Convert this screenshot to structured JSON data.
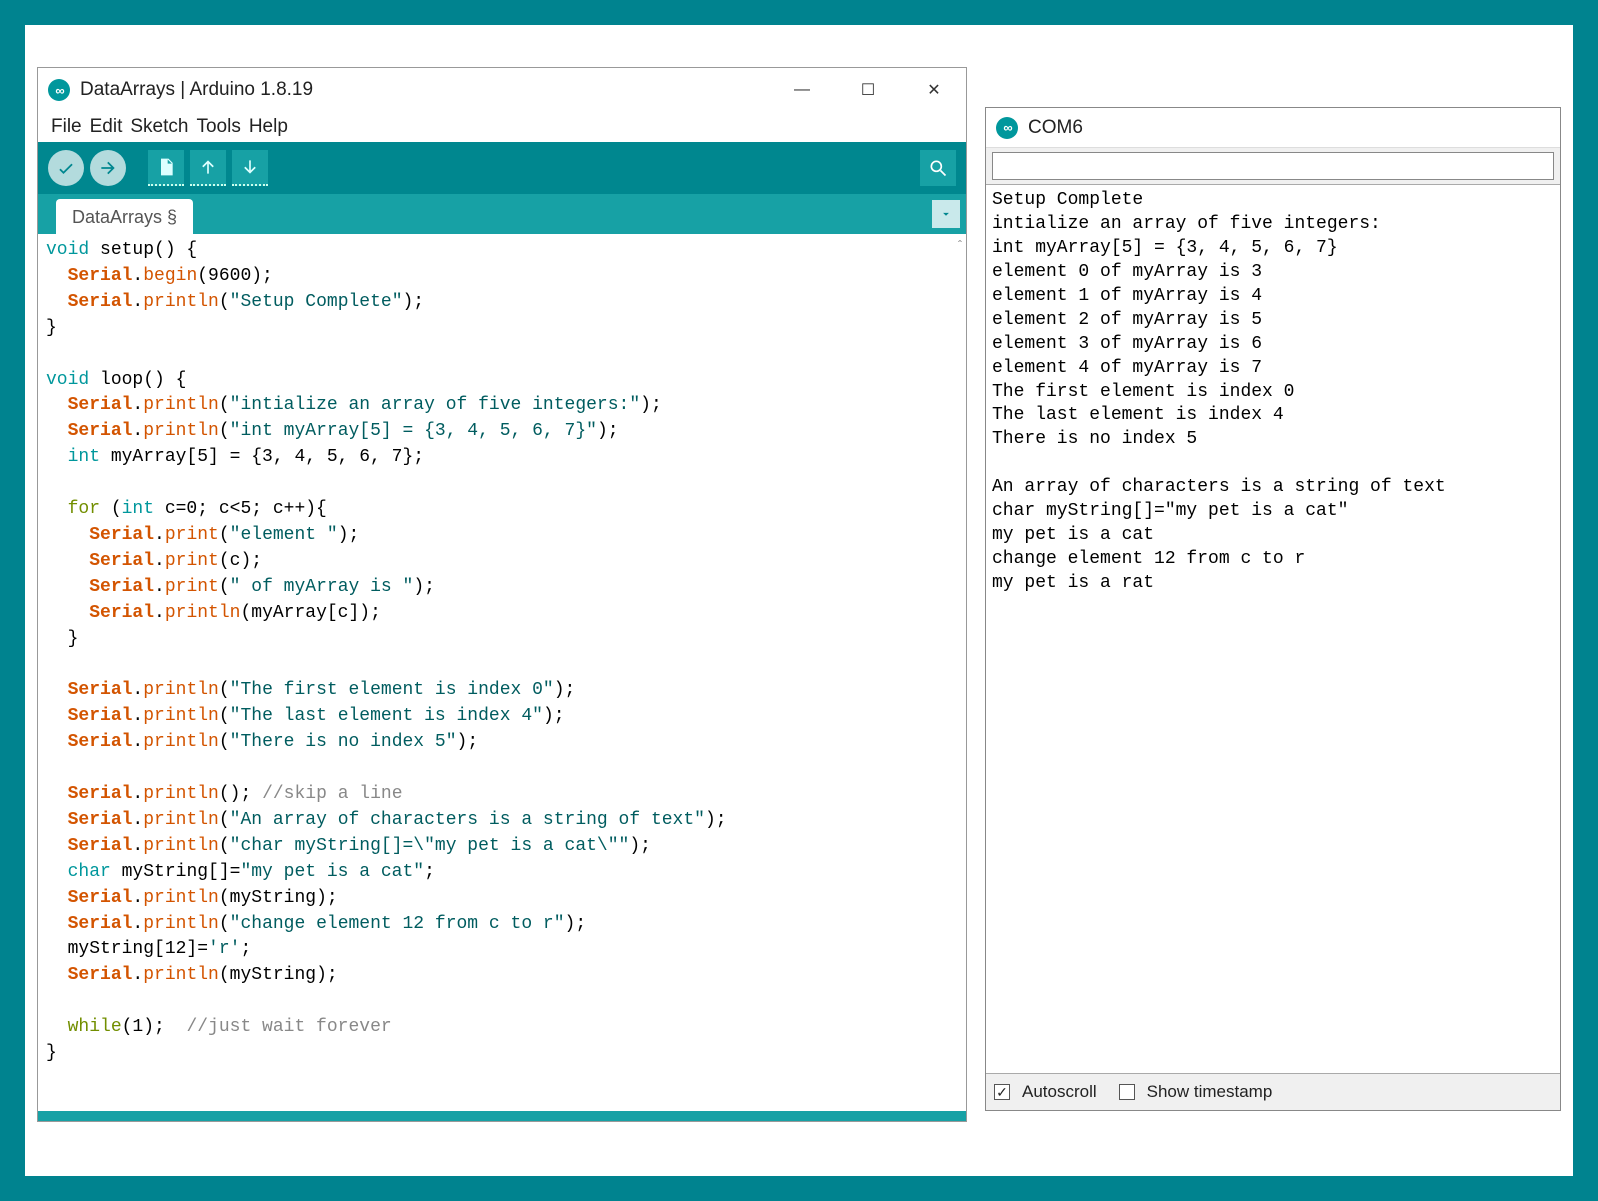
{
  "ide": {
    "title": "DataArrays | Arduino 1.8.19",
    "menubar": [
      "File",
      "Edit",
      "Sketch",
      "Tools",
      "Help"
    ],
    "tab": "DataArrays §",
    "code_tokens": [
      [
        [
          "kw-type",
          "void"
        ],
        [
          "",
          " setup() {"
        ]
      ],
      [
        [
          "",
          "  "
        ],
        [
          "kw-serial",
          "Serial"
        ],
        [
          "",
          "."
        ],
        [
          "kw-func",
          "begin"
        ],
        [
          "",
          "(9600);"
        ]
      ],
      [
        [
          "",
          "  "
        ],
        [
          "kw-serial",
          "Serial"
        ],
        [
          "",
          "."
        ],
        [
          "kw-func",
          "println"
        ],
        [
          "",
          "("
        ],
        [
          "str",
          "\"Setup Complete\""
        ],
        [
          "",
          ");"
        ]
      ],
      [
        [
          "",
          "}"
        ]
      ],
      [
        [
          "",
          ""
        ]
      ],
      [
        [
          "kw-type",
          "void"
        ],
        [
          "",
          " loop() {"
        ]
      ],
      [
        [
          "",
          "  "
        ],
        [
          "kw-serial",
          "Serial"
        ],
        [
          "",
          "."
        ],
        [
          "kw-func",
          "println"
        ],
        [
          "",
          "("
        ],
        [
          "str",
          "\"intialize an array of five integers:\""
        ],
        [
          "",
          ");"
        ]
      ],
      [
        [
          "",
          "  "
        ],
        [
          "kw-serial",
          "Serial"
        ],
        [
          "",
          "."
        ],
        [
          "kw-func",
          "println"
        ],
        [
          "",
          "("
        ],
        [
          "str",
          "\"int myArray[5] = {3, 4, 5, 6, 7}\""
        ],
        [
          "",
          ");"
        ]
      ],
      [
        [
          "",
          "  "
        ],
        [
          "kw-type",
          "int"
        ],
        [
          "",
          " myArray[5] = {3, 4, 5, 6, 7};"
        ]
      ],
      [
        [
          "",
          ""
        ]
      ],
      [
        [
          "",
          "  "
        ],
        [
          "kw-ctrl",
          "for"
        ],
        [
          "",
          " ("
        ],
        [
          "kw-type",
          "int"
        ],
        [
          "",
          " c=0; c<5; c++){"
        ]
      ],
      [
        [
          "",
          "    "
        ],
        [
          "kw-serial",
          "Serial"
        ],
        [
          "",
          "."
        ],
        [
          "kw-func",
          "print"
        ],
        [
          "",
          "("
        ],
        [
          "str",
          "\"element \""
        ],
        [
          "",
          ");"
        ]
      ],
      [
        [
          "",
          "    "
        ],
        [
          "kw-serial",
          "Serial"
        ],
        [
          "",
          "."
        ],
        [
          "kw-func",
          "print"
        ],
        [
          "",
          "(c);"
        ]
      ],
      [
        [
          "",
          "    "
        ],
        [
          "kw-serial",
          "Serial"
        ],
        [
          "",
          "."
        ],
        [
          "kw-func",
          "print"
        ],
        [
          "",
          "("
        ],
        [
          "str",
          "\" of myArray is \""
        ],
        [
          "",
          ");"
        ]
      ],
      [
        [
          "",
          "    "
        ],
        [
          "kw-serial",
          "Serial"
        ],
        [
          "",
          "."
        ],
        [
          "kw-func",
          "println"
        ],
        [
          "",
          "(myArray[c]);"
        ]
      ],
      [
        [
          "",
          "  }"
        ]
      ],
      [
        [
          "",
          ""
        ]
      ],
      [
        [
          "",
          "  "
        ],
        [
          "kw-serial",
          "Serial"
        ],
        [
          "",
          "."
        ],
        [
          "kw-func",
          "println"
        ],
        [
          "",
          "("
        ],
        [
          "str",
          "\"The first element is index 0\""
        ],
        [
          "",
          ");"
        ]
      ],
      [
        [
          "",
          "  "
        ],
        [
          "kw-serial",
          "Serial"
        ],
        [
          "",
          "."
        ],
        [
          "kw-func",
          "println"
        ],
        [
          "",
          "("
        ],
        [
          "str",
          "\"The last element is index 4\""
        ],
        [
          "",
          ");"
        ]
      ],
      [
        [
          "",
          "  "
        ],
        [
          "kw-serial",
          "Serial"
        ],
        [
          "",
          "."
        ],
        [
          "kw-func",
          "println"
        ],
        [
          "",
          "("
        ],
        [
          "str",
          "\"There is no index 5\""
        ],
        [
          "",
          ");"
        ]
      ],
      [
        [
          "",
          ""
        ]
      ],
      [
        [
          "",
          "  "
        ],
        [
          "kw-serial",
          "Serial"
        ],
        [
          "",
          "."
        ],
        [
          "kw-func",
          "println"
        ],
        [
          "",
          "(); "
        ],
        [
          "cmt",
          "//skip a line"
        ]
      ],
      [
        [
          "",
          "  "
        ],
        [
          "kw-serial",
          "Serial"
        ],
        [
          "",
          "."
        ],
        [
          "kw-func",
          "println"
        ],
        [
          "",
          "("
        ],
        [
          "str",
          "\"An array of characters is a string of text\""
        ],
        [
          "",
          ");"
        ]
      ],
      [
        [
          "",
          "  "
        ],
        [
          "kw-serial",
          "Serial"
        ],
        [
          "",
          "."
        ],
        [
          "kw-func",
          "println"
        ],
        [
          "",
          "("
        ],
        [
          "str",
          "\"char myString[]=\\\"my pet is a cat\\\"\""
        ],
        [
          "",
          ");"
        ]
      ],
      [
        [
          "",
          "  "
        ],
        [
          "kw-type",
          "char"
        ],
        [
          "",
          " myString[]="
        ],
        [
          "str",
          "\"my pet is a cat\""
        ],
        [
          "",
          ";"
        ]
      ],
      [
        [
          "",
          "  "
        ],
        [
          "kw-serial",
          "Serial"
        ],
        [
          "",
          "."
        ],
        [
          "kw-func",
          "println"
        ],
        [
          "",
          "(myString);"
        ]
      ],
      [
        [
          "",
          "  "
        ],
        [
          "kw-serial",
          "Serial"
        ],
        [
          "",
          "."
        ],
        [
          "kw-func",
          "println"
        ],
        [
          "",
          "("
        ],
        [
          "str",
          "\"change element 12 from c to r\""
        ],
        [
          "",
          ");"
        ]
      ],
      [
        [
          "",
          "  myString[12]="
        ],
        [
          "str",
          "'r'"
        ],
        [
          "",
          ";"
        ]
      ],
      [
        [
          "",
          "  "
        ],
        [
          "kw-serial",
          "Serial"
        ],
        [
          "",
          "."
        ],
        [
          "kw-func",
          "println"
        ],
        [
          "",
          "(myString);"
        ]
      ],
      [
        [
          "",
          ""
        ]
      ],
      [
        [
          "",
          "  "
        ],
        [
          "kw-ctrl",
          "while"
        ],
        [
          "",
          "(1);  "
        ],
        [
          "cmt",
          "//just wait forever"
        ]
      ],
      [
        [
          "",
          "}"
        ]
      ]
    ]
  },
  "serial": {
    "title": "COM6",
    "input_value": "",
    "output": "Setup Complete\nintialize an array of five integers:\nint myArray[5] = {3, 4, 5, 6, 7}\nelement 0 of myArray is 3\nelement 1 of myArray is 4\nelement 2 of myArray is 5\nelement 3 of myArray is 6\nelement 4 of myArray is 7\nThe first element is index 0\nThe last element is index 4\nThere is no index 5\n\nAn array of characters is a string of text\nchar myString[]=\"my pet is a cat\"\nmy pet is a cat\nchange element 12 from c to r\nmy pet is a rat",
    "footer": {
      "autoscroll_label": "Autoscroll",
      "autoscroll_checked": true,
      "timestamp_label": "Show timestamp",
      "timestamp_checked": false
    }
  }
}
